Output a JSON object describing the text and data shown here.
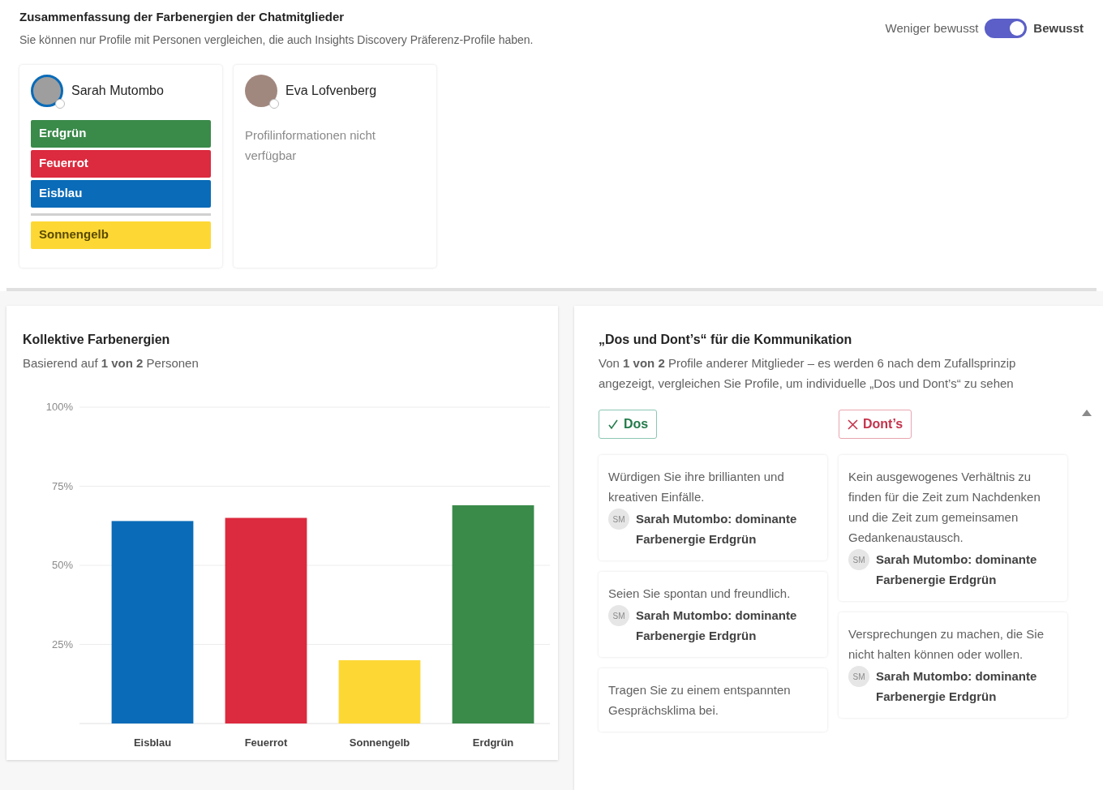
{
  "header": {
    "title": "Zusammenfassung der Farbenergien der Chatmitglieder",
    "subtitle": "Sie können nur Profile mit Personen vergleichen, die auch Insights Discovery Präferenz-Profile haben."
  },
  "toggle": {
    "label_off": "Weniger bewusst",
    "label_on": "Bewusst",
    "on": true
  },
  "members": [
    {
      "name": "Sarah Mutombo",
      "energies": [
        {
          "kind": "energy",
          "label": "Erdgrün",
          "color": "#3a8a4a"
        },
        {
          "kind": "energy",
          "label": "Feuerrot",
          "color": "#dc2a3e"
        },
        {
          "kind": "energy",
          "label": "Eisblau",
          "color": "#0a6bb8"
        },
        {
          "kind": "separator"
        },
        {
          "kind": "energy",
          "label": "Sonnengelb",
          "color": "#fdd835"
        }
      ]
    },
    {
      "name": "Eva Lofvenberg",
      "note": "Profilinformationen nicht verfügbar"
    }
  ],
  "collective": {
    "title": "Kollektive Farbenergien",
    "subtitle": "Basierend auf **1 von 2** Personen",
    "chart_data": {
      "type": "bar",
      "grid": true,
      "stacked": true,
      "series": [
        {
          "name": "Eisblau",
          "color": "#0a6bb8",
          "values": [
            64,
            null,
            null,
            null
          ]
        },
        {
          "name": "Feuerrot",
          "color": "#dc2a3e",
          "values": [
            null,
            65,
            null,
            null
          ]
        },
        {
          "name": "Sonnengelb",
          "color": "#fdd835",
          "values": [
            null,
            null,
            20,
            null
          ]
        },
        {
          "name": "Erdgrün",
          "color": "#3a8a4a",
          "values": [
            null,
            null,
            null,
            69
          ]
        }
      ],
      "ylim": [
        0,
        100
      ],
      "yticks": [
        {
          "value": 25,
          "label": "25%"
        },
        {
          "value": 50,
          "label": "50%"
        },
        {
          "value": 75,
          "label": "75%"
        },
        {
          "value": 100,
          "label": "100%"
        }
      ]
    }
  },
  "dos_donts": {
    "title": "„Dos und Dont’s“ für die Kommunikation",
    "subtitle": "Von **1 von 2** Profile anderer Mitglieder – es werden 6 nach dem Zufallsprinzip angezeigt, vergleichen Sie Profile, um individuelle „Dos und Dont’s“ zu sehen",
    "columns": [
      {
        "kind": "dos",
        "label": "Dos",
        "items": [
          {
            "text": "Würdigen Sie ihre brillianten und kreativen Einfälle.",
            "initials": "SM",
            "source": "Sarah Mutombo: dominante Farbenergie Erdgrün"
          },
          {
            "text": "Seien Sie spontan und freundlich.",
            "initials": "SM",
            "source": "Sarah Mutombo: dominante Farbenergie Erdgrün"
          },
          {
            "text": "Tragen Sie zu einem entspannten Gesprächsklima bei."
          }
        ]
      },
      {
        "kind": "donts",
        "label": "Dont’s",
        "items": [
          {
            "text": "Kein ausgewogenes Verhältnis zu finden für die Zeit zum Nachdenken und die Zeit zum gemeinsamen Gedankenaustausch.",
            "initials": "SM",
            "source": "Sarah Mutombo: dominante Farbenergie Erdgrün"
          },
          {
            "text": "Versprechungen zu machen, die Sie nicht halten können oder wollen.",
            "initials": "SM",
            "source": "Sarah Mutombo: dominante Farbenergie Erdgrün"
          }
        ]
      }
    ]
  }
}
